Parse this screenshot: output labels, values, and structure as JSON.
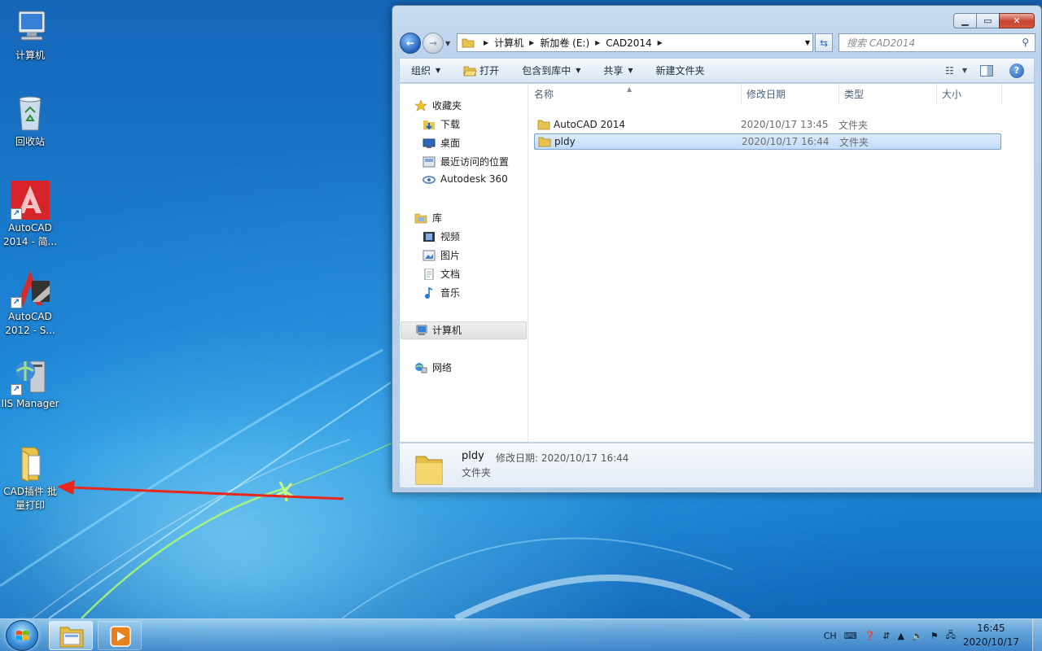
{
  "desktop": {
    "icons": [
      {
        "label": "计算机",
        "icon": "computer-icon"
      },
      {
        "label": "回收站",
        "icon": "recycle-bin-icon"
      },
      {
        "label": "AutoCAD 2014 - 简...",
        "icon": "autocad-2014-icon"
      },
      {
        "label": "AutoCAD 2012 - S...",
        "icon": "autocad-2012-icon"
      },
      {
        "label": "IIS Manager",
        "icon": "iis-manager-icon"
      },
      {
        "label": "CAD插件 批量打印",
        "icon": "folder-icon"
      }
    ]
  },
  "window": {
    "address": [
      "计算机",
      "新加卷 (E:)",
      "CAD2014"
    ],
    "search_placeholder": "搜索 CAD2014",
    "toolbar": {
      "organize": "组织",
      "open": "打开",
      "include_in_library": "包含到库中",
      "share": "共享",
      "new_folder": "新建文件夹"
    },
    "nav": {
      "favorites": "收藏夹",
      "downloads": "下载",
      "desktop": "桌面",
      "recent": "最近访问的位置",
      "autodesk360": "Autodesk 360",
      "libraries": "库",
      "videos": "视频",
      "pictures": "图片",
      "documents": "文档",
      "music": "音乐",
      "computer": "计算机",
      "network": "网络"
    },
    "columns": {
      "name": "名称",
      "date": "修改日期",
      "type": "类型",
      "size": "大小"
    },
    "files": [
      {
        "name": "AutoCAD 2014",
        "date": "2020/10/17 13:45",
        "type": "文件夹",
        "selected": false
      },
      {
        "name": "pldy",
        "date": "2020/10/17 16:44",
        "type": "文件夹",
        "selected": true
      }
    ],
    "details": {
      "name": "pldy",
      "modified_label": "修改日期:",
      "modified_value": "2020/10/17 16:44",
      "type": "文件夹"
    }
  },
  "taskbar": {
    "lang": "CH",
    "time": "16:45",
    "date": "2020/10/17"
  },
  "colors": {
    "accent": "#1c6fc9",
    "selection": "#c2dcfa",
    "arrow": "#e8261c"
  }
}
